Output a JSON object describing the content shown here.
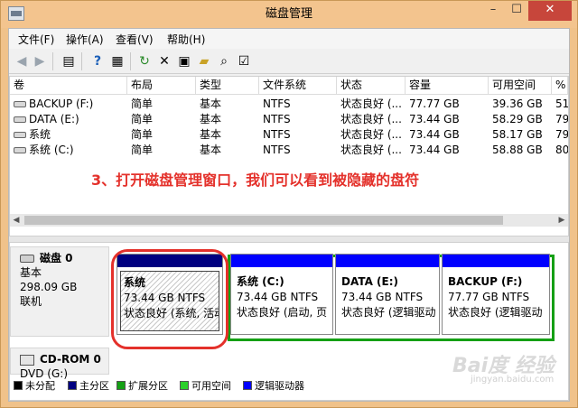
{
  "window": {
    "title": "磁盘管理"
  },
  "menu": [
    "文件(F)",
    "操作(A)",
    "查看(V)",
    "帮助(H)"
  ],
  "toolbar": {
    "icons": [
      "back-arrow-icon",
      "forward-arrow-icon",
      "list-view-icon",
      "help-icon",
      "properties-pane-icon",
      "refresh-icon",
      "delete-icon",
      "properties-icon",
      "open-folder-icon",
      "search-icon",
      "checklist-icon"
    ]
  },
  "volume_table": {
    "headers": [
      "卷",
      "布局",
      "类型",
      "文件系统",
      "状态",
      "容量",
      "可用空间",
      "%"
    ],
    "rows": [
      [
        "BACKUP (F:)",
        "简单",
        "基本",
        "NTFS",
        "状态良好 (...",
        "77.77 GB",
        "39.36 GB",
        "51"
      ],
      [
        "DATA (E:)",
        "简单",
        "基本",
        "NTFS",
        "状态良好 (...",
        "73.44 GB",
        "58.29 GB",
        "79"
      ],
      [
        "系统",
        "简单",
        "基本",
        "NTFS",
        "状态良好 (...",
        "73.44 GB",
        "58.17 GB",
        "79"
      ],
      [
        "系统 (C:)",
        "简单",
        "基本",
        "NTFS",
        "状态良好 (...",
        "73.44 GB",
        "58.88 GB",
        "80"
      ]
    ]
  },
  "annotation": "3、打开磁盘管理窗口，我们可以看到被隐藏的盘符",
  "disk0": {
    "name": "磁盘 0",
    "type": "基本",
    "size": "298.09 GB",
    "status": "联机",
    "partitions": [
      {
        "name": "系统",
        "size": "73.44 GB NTFS",
        "status": "状态良好 (系统, 活动",
        "bar_color": "#000080"
      },
      {
        "name": "系统 (C:)",
        "size": "73.44 GB NTFS",
        "status": "状态良好 (启动, 页",
        "bar_color": "#0000ff"
      },
      {
        "name": "DATA (E:)",
        "size": "73.44 GB NTFS",
        "status": "状态良好 (逻辑驱动",
        "bar_color": "#0000ff"
      },
      {
        "name": "BACKUP (F:)",
        "size": "77.77 GB NTFS",
        "status": "状态良好 (逻辑驱动",
        "bar_color": "#0000ff"
      }
    ]
  },
  "cdrom0": {
    "name": "CD-ROM 0",
    "drive": "DVD (G:)"
  },
  "legend": [
    {
      "label": "未分配",
      "color": "#000000"
    },
    {
      "label": "主分区",
      "color": "#000080"
    },
    {
      "label": "扩展分区",
      "color": "#15a015"
    },
    {
      "label": "可用空间",
      "color": "#2bd12b"
    },
    {
      "label": "逻辑驱动器",
      "color": "#0000ff"
    }
  ],
  "watermark": {
    "brand": "Bai度 经验",
    "url": "jingyan.baidu.com"
  }
}
